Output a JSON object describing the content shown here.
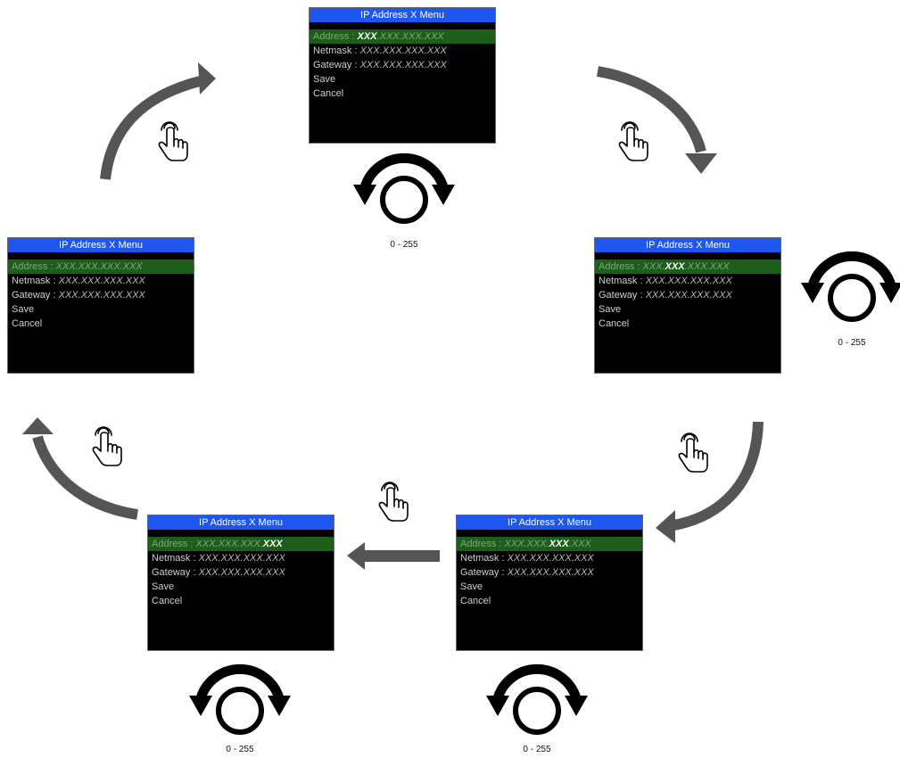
{
  "menu_title": "IP Address X Menu",
  "labels": {
    "address": "Address",
    "netmask": "Netmask",
    "gateway": "Gateway",
    "save": "Save",
    "cancel": "Cancel",
    "sep": " : "
  },
  "ip_placeholder": "XXX.XXX.XXX.XXX",
  "octet": "XXX",
  "knob_range": "0 - 255",
  "colors": {
    "title_bar": "#1e56f0",
    "selected_row": "#1d5e1a",
    "arrow": "#555555"
  },
  "screens": [
    {
      "id": "screen-address-idle",
      "address_parts": [
        "",
        "",
        "XXX.XXX.XXX.XXX"
      ],
      "icons": [
        "pointing-hand-icon"
      ]
    },
    {
      "id": "screen-octet-1",
      "address_parts": [
        "",
        "XXX",
        ".XXX.XXX.XXX"
      ],
      "icons": [
        "rotary-knob-icon",
        "pointing-hand-icon"
      ]
    },
    {
      "id": "screen-octet-2",
      "address_parts": [
        "XXX.",
        "XXX",
        ".XXX.XXX"
      ],
      "icons": [
        "rotary-knob-icon",
        "pointing-hand-icon"
      ]
    },
    {
      "id": "screen-octet-3",
      "address_parts": [
        "XXX.XXX.",
        "XXX",
        ".XXX"
      ],
      "icons": [
        "rotary-knob-icon",
        "pointing-hand-icon"
      ]
    },
    {
      "id": "screen-octet-4",
      "address_parts": [
        "XXX.XXX.XXX.",
        "XXX",
        ""
      ],
      "icons": [
        "rotary-knob-icon",
        "pointing-hand-icon"
      ]
    }
  ]
}
